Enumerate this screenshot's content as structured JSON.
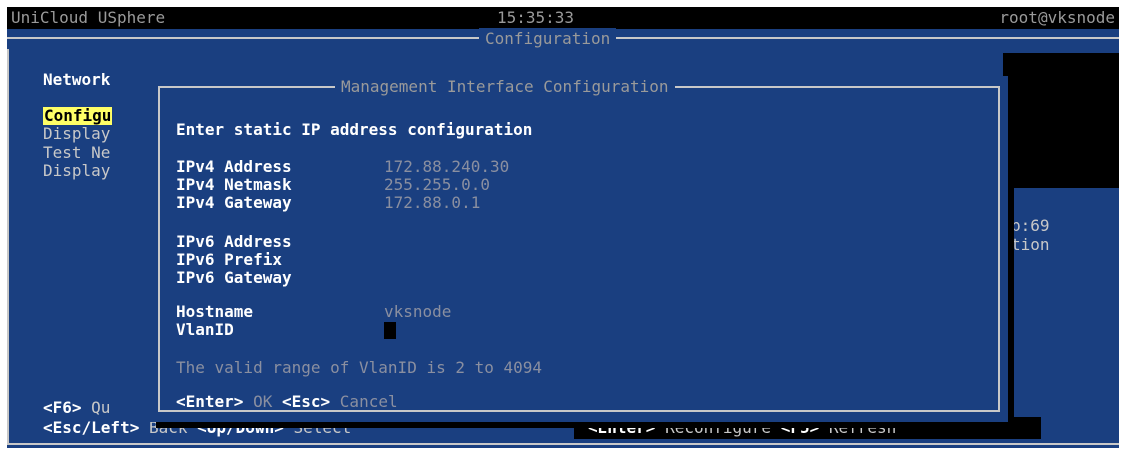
{
  "topbar": {
    "product": "UniCloud USphere",
    "time": "15:35:33",
    "user": "root@vksnode"
  },
  "main_screen": {
    "title": "Configuration",
    "section": "Network",
    "menu": [
      {
        "text": "Configu",
        "selected": true
      },
      {
        "text": "Display",
        "selected": false
      },
      {
        "text": "Test Ne",
        "selected": false
      },
      {
        "text": "Display",
        "selected": false
      }
    ],
    "right_fragments": [
      "b:69",
      "tion"
    ],
    "f6_key": "<F6>",
    "f6_label": "Qu",
    "bottom_keys": [
      {
        "key": "<Esc/Left>",
        "label": "Back"
      },
      {
        "key": "<Up/Down>",
        "label": "Select"
      },
      {
        "key": "<Enter>",
        "label": "Reconfigure"
      },
      {
        "key": "<F5>",
        "label": "Refresh"
      }
    ]
  },
  "dialog": {
    "title": "Management Interface Configuration",
    "heading": "Enter static IP address configuration",
    "fields": [
      {
        "label": "IPv4 Address",
        "value": "172.88.240.30"
      },
      {
        "label": "IPv4 Netmask",
        "value": "255.255.0.0"
      },
      {
        "label": "IPv4 Gateway",
        "value": "172.88.0.1"
      },
      {
        "label": "IPv6 Address",
        "value": ""
      },
      {
        "label": "IPv6 Prefix",
        "value": ""
      },
      {
        "label": "IPv6 Gateway",
        "value": ""
      },
      {
        "label": "Hostname",
        "value": "vksnode"
      },
      {
        "label": "VlanID",
        "value": ""
      }
    ],
    "hint": "The valid range of VlanID is 2 to 4094",
    "buttons": [
      {
        "key": "<Enter>",
        "label": "OK"
      },
      {
        "key": "<Esc>",
        "label": "Cancel"
      }
    ]
  },
  "colors": {
    "background": "#1a3f80",
    "highlight": "#ffff66",
    "value_text": "#8a8fa0",
    "frame": "#c8c8c8"
  }
}
